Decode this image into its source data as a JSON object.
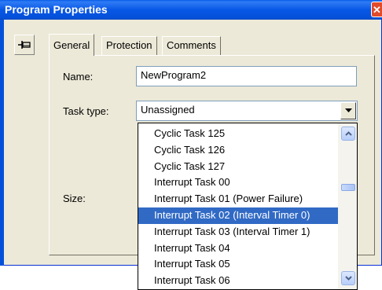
{
  "window": {
    "title": "Program Properties",
    "close_glyph": "✕"
  },
  "tabs": [
    {
      "label": "General",
      "active": true
    },
    {
      "label": "Protection",
      "active": false
    },
    {
      "label": "Comments",
      "active": false
    }
  ],
  "form": {
    "name_label": "Name:",
    "name_value": "NewProgram2",
    "task_type_label": "Task type:",
    "task_type_value": "Unassigned",
    "size_label": "Size:"
  },
  "dropdown": {
    "items": [
      "Cyclic Task 125",
      "Cyclic Task 126",
      "Cyclic Task 127",
      "Interrupt Task 00",
      "Interrupt Task 01 (Power Failure)",
      "Interrupt Task 02 (Interval Timer 0)",
      "Interrupt Task 03 (Interval Timer 1)",
      "Interrupt Task 04",
      "Interrupt Task 05",
      "Interrupt Task 06"
    ],
    "selected_index": 5
  },
  "colors": {
    "title_bar": "#0451d9",
    "selection": "#316ac5",
    "dialog_face": "#ece9d8"
  },
  "icons": {
    "pin": "pin-icon",
    "combo_arrow": "chevron-down-icon",
    "scroll_up": "scroll-up-icon",
    "scroll_down": "scroll-down-icon"
  }
}
